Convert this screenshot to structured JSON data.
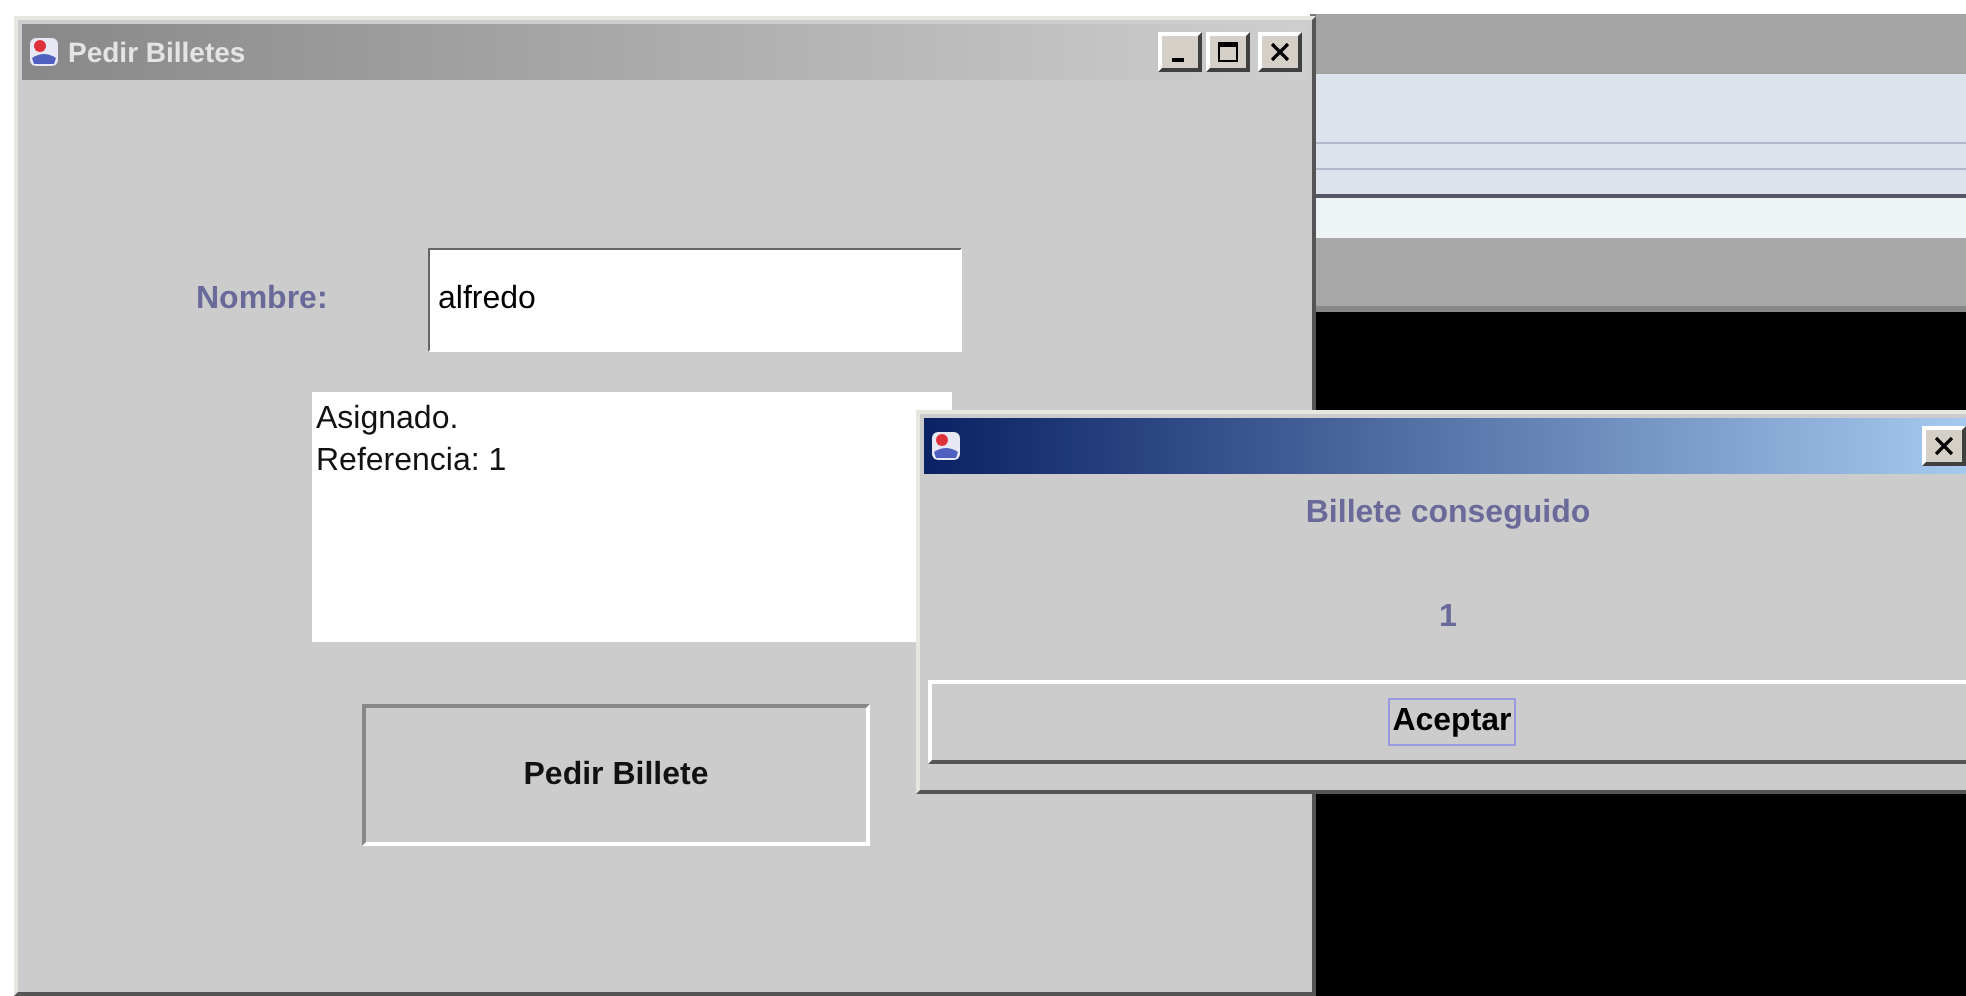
{
  "main_window": {
    "title": "Pedir Billetes",
    "name_label": "Nombre:",
    "name_value": "alfredo",
    "output_lines": [
      "Asignado.",
      "Referencia: 1"
    ],
    "button": "Pedir Billete"
  },
  "dialog": {
    "message": "Billete conseguido",
    "value": "1",
    "button": "Aceptar"
  }
}
